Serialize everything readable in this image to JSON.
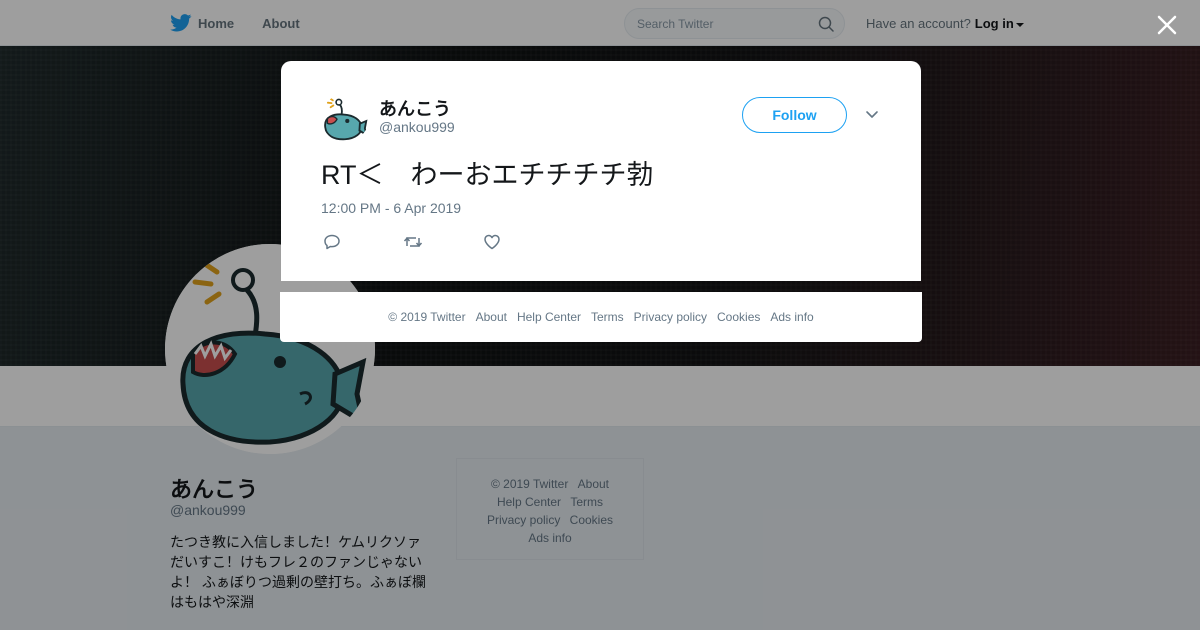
{
  "nav": {
    "home_label": "Home",
    "about_label": "About",
    "search_placeholder": "Search Twitter",
    "have_account": "Have an account?",
    "login_label": "Log in"
  },
  "profile": {
    "name": "あんこう",
    "handle": "@ankou999",
    "bio": "たつき教に入信しました！ケムリクソァだいすこ！けもフレ２のファンじゃないよ！ ふぁぼりつ過剰の壁打ち。ふぁぼ欄はもはや深淵"
  },
  "side_footer": {
    "copyright": "© 2019 Twitter",
    "about": "About",
    "help": "Help Center",
    "terms": "Terms",
    "privacy": "Privacy policy",
    "cookies": "Cookies",
    "ads": "Ads info"
  },
  "tweet": {
    "name": "あんこう",
    "handle": "@ankou999",
    "follow_label": "Follow",
    "text": "RT＜　わーおエチチチチ勃",
    "timestamp": "12:00 PM - 6 Apr 2019"
  },
  "modal_footer": {
    "copyright": "© 2019 Twitter",
    "about": "About",
    "help": "Help Center",
    "terms": "Terms",
    "privacy": "Privacy policy",
    "cookies": "Cookies",
    "ads": "Ads info"
  },
  "icons": {
    "logo": "twitter-bird-icon",
    "search": "search-icon",
    "close": "close-icon",
    "chevron": "chevron-down-icon",
    "reply": "reply-icon",
    "retweet": "retweet-icon",
    "like": "heart-icon"
  },
  "colors": {
    "brand": "#1da1f2",
    "text_secondary": "#657786"
  }
}
